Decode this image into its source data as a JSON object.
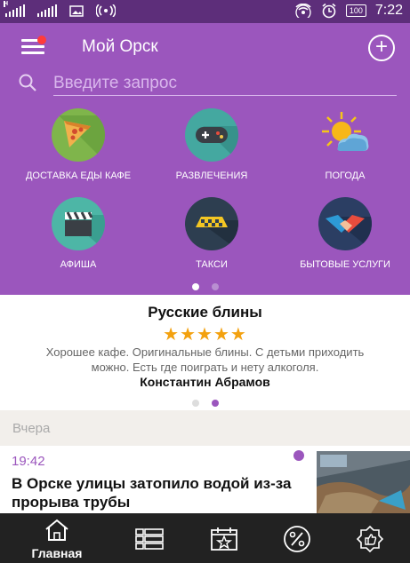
{
  "status": {
    "battery": "100",
    "time": "7:22"
  },
  "app": {
    "title": "Мой Орск"
  },
  "search": {
    "placeholder": "Введите запрос"
  },
  "categories": [
    {
      "label": "ДОСТАВКА ЕДЫ КАФЕ",
      "icon": "pizza-icon"
    },
    {
      "label": "РАЗВЛЕЧЕНИЯ",
      "icon": "gamepad-icon"
    },
    {
      "label": "ПОГОДА",
      "icon": "weather-icon"
    },
    {
      "label": "АФИША",
      "icon": "clapperboard-icon"
    },
    {
      "label": "ТАКСИ",
      "icon": "taxi-icon"
    },
    {
      "label": "БЫТОВЫЕ УСЛУГИ",
      "icon": "handshake-icon"
    }
  ],
  "review": {
    "title": "Русские блины",
    "rating": 5,
    "stars": "★★★★★",
    "text": "Хорошее кафе. Оригинальные блины. С детьми приходить можно. Есть где поиграть и нету алкоголя.",
    "author": "Константин Абрамов"
  },
  "news": {
    "section": "Вчера",
    "items": [
      {
        "time": "19:42",
        "title": "В Орске улицы затопило водой из-за прорыва трубы"
      }
    ]
  },
  "nav": {
    "home_label": "Главная"
  },
  "colors": {
    "primary": "#9b56bd",
    "statusbar": "#5d2e7a",
    "star": "#f3a10f",
    "navbar": "#222222"
  }
}
